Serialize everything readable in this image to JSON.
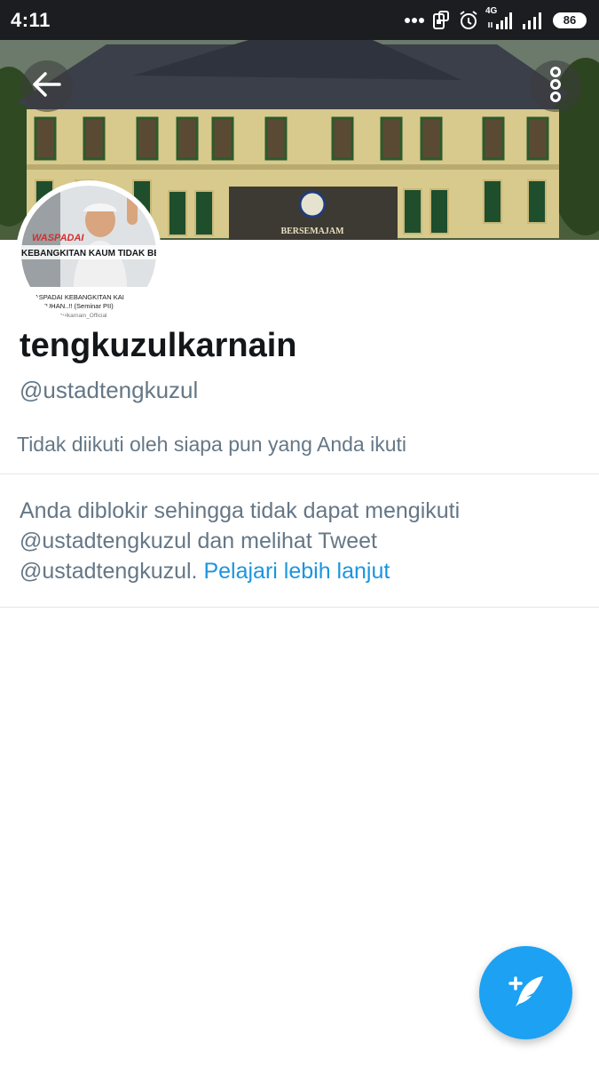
{
  "status_bar": {
    "time": "4:11",
    "network_label": "4G",
    "battery_level": "86"
  },
  "banner": {
    "sign_text": "BERSEMAJAM"
  },
  "avatar": {
    "overlay_title": "WASPADAI",
    "overlay_subtitle": "KEBANGKITAN KAUM TIDAK BE",
    "caption_line1": "WASPADAI KEBANGKITAN KAI",
    "caption_line2": "BERTUHAN..!! (Seminar PII)",
    "caption_line3": "tengkuzulkarnain_Official"
  },
  "profile": {
    "display_name": "tengkuzulkarnain",
    "handle": "@ustadtengkuzul",
    "follow_context": "Tidak diikuti oleh siapa pun yang Anda ikuti"
  },
  "blocked_notice": {
    "line1": "Anda diblokir sehingga tidak dapat mengikuti",
    "line2": "@ustadtengkuzul dan melihat Tweet",
    "line3": "@ustadtengkuzul.",
    "link_text": "Pelajari lebih lanjut"
  },
  "icons": {
    "back": "arrow-left-icon",
    "more": "vertical-dots-icon",
    "compose": "compose-tweet-icon"
  },
  "colors": {
    "accent": "#1da1f2",
    "link": "#1b95e0",
    "secondary_text": "#657786",
    "primary_text": "#14171a"
  }
}
